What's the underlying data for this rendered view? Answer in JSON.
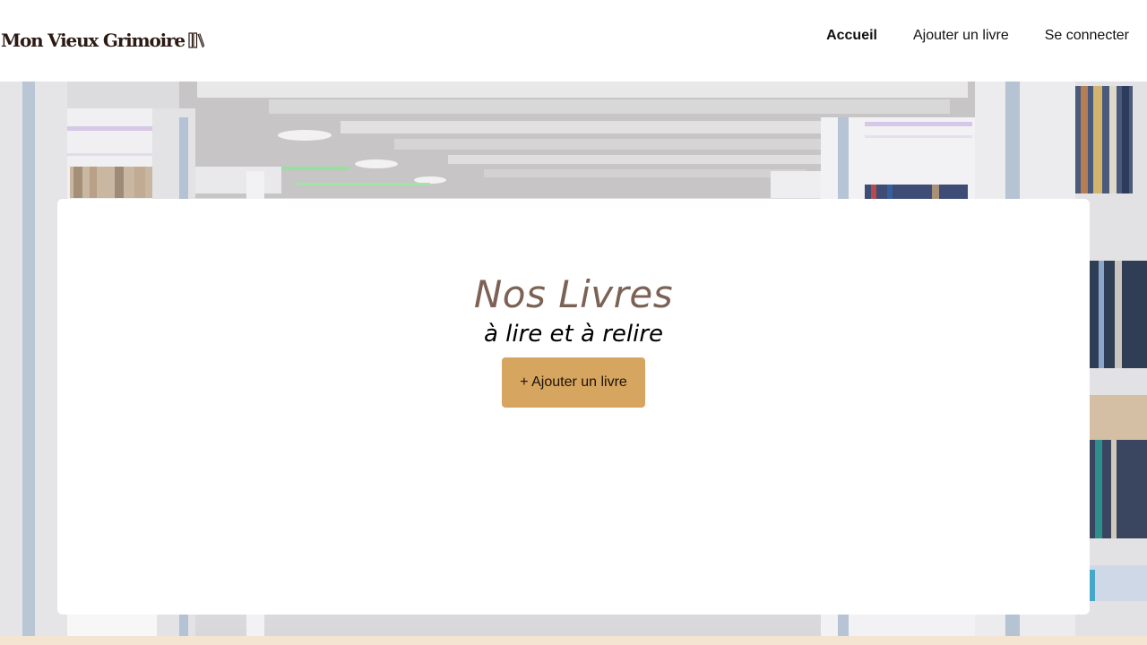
{
  "header": {
    "logo_text": "Mon Vieux Grimoire",
    "nav": {
      "home": "Accueil",
      "add_book": "Ajouter un livre",
      "login": "Se connecter"
    }
  },
  "hero": {
    "title": "Nos Livres",
    "subtitle": "à lire et à relire",
    "add_button": "+ Ajouter un livre"
  },
  "colors": {
    "accent": "#d6a55f",
    "title": "#7b6254",
    "logo": "#2c1a14",
    "footer_strip": "#f4e5d2"
  },
  "icons": [
    "books-icon"
  ]
}
